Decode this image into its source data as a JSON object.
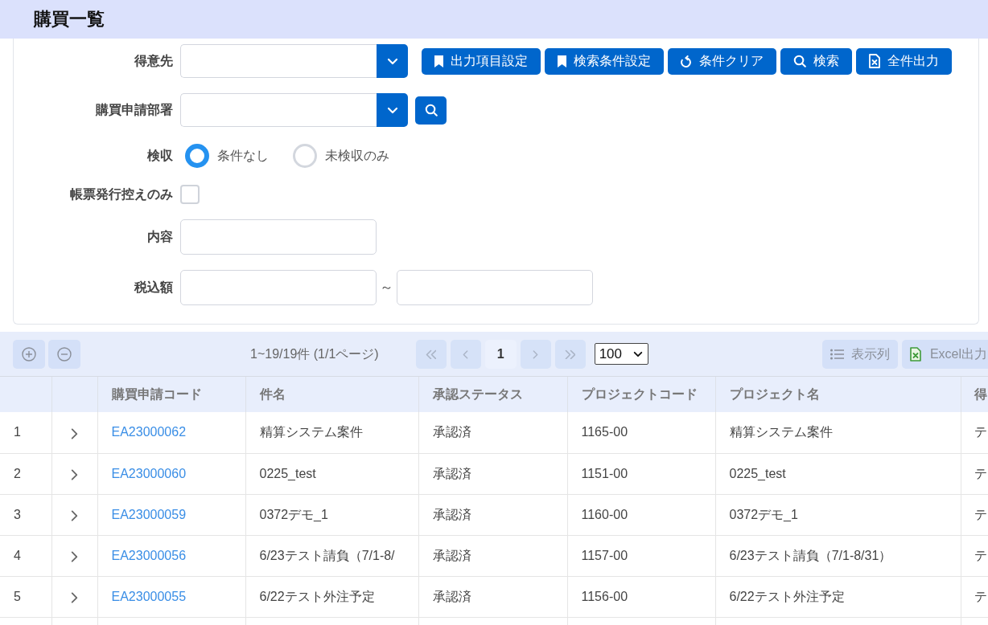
{
  "header": {
    "title": "購買一覧"
  },
  "search_form": {
    "fields": [
      {
        "kind": "combo",
        "label": "得意先",
        "actions": [
          {
            "kind": "preset",
            "label": "出力項目設定"
          },
          {
            "kind": "preset",
            "label": "検索条件設定"
          },
          {
            "kind": "reset",
            "label": "条件クリア"
          },
          {
            "kind": "search",
            "label": "検索"
          },
          {
            "kind": "export",
            "label": "全件出力"
          }
        ]
      },
      {
        "kind": "combo_search",
        "label": "購買申請部署"
      },
      {
        "kind": "radio",
        "label": "検収",
        "options": [
          {
            "label": "条件なし",
            "selected": true
          },
          {
            "label": "未検収のみ",
            "selected": false
          }
        ]
      },
      {
        "kind": "checkbox",
        "label": "帳票発行控えのみ",
        "checked": false
      },
      {
        "kind": "text",
        "label": "内容"
      },
      {
        "kind": "range",
        "label": "税込額",
        "separator": "～"
      }
    ]
  },
  "toolbar": {
    "summary": "1~19/19件 (1/1ページ)",
    "pages": [
      {
        "label": "1",
        "selected": true
      }
    ],
    "page_size": "100",
    "buttons": [
      {
        "kind": "columns",
        "label": "表示列"
      },
      {
        "kind": "excel",
        "label": "Excel出力"
      }
    ]
  },
  "table": {
    "columns": [
      "購買申請コード",
      "件名",
      "承認ステータス",
      "プロジェクトコード",
      "プロジェクト名",
      "得"
    ],
    "rows": [
      {
        "number": "1",
        "expanded": false,
        "code": "EA23000062",
        "title": "精算システム案件",
        "status": "承認済",
        "project_code": "1165-00",
        "project_name": "精算システム案件",
        "column_8": "テ"
      },
      {
        "number": "2",
        "expanded": false,
        "code": "EA23000060",
        "title": "0225_test",
        "status": "承認済",
        "project_code": "1151-00",
        "project_name": "0225_test",
        "column_8": "テ"
      },
      {
        "number": "3",
        "expanded": false,
        "code": "EA23000059",
        "title": "0372デモ_1",
        "status": "承認済",
        "project_code": "1160-00",
        "project_name": "0372デモ_1",
        "column_8": "テ"
      },
      {
        "number": "4",
        "expanded": false,
        "code": "EA23000056",
        "title": "6/23テスト請負（7/1-8/",
        "status": "承認済",
        "project_code": "1157-00",
        "project_name": "6/23テスト請負（7/1-8/31）",
        "column_8": "テ"
      },
      {
        "number": "5",
        "expanded": false,
        "code": "EA23000055",
        "title": "6/22テスト外注予定",
        "status": "承認済",
        "project_code": "1156-00",
        "project_name": "6/22テスト外注予定",
        "column_8": "テ"
      }
    ]
  }
}
